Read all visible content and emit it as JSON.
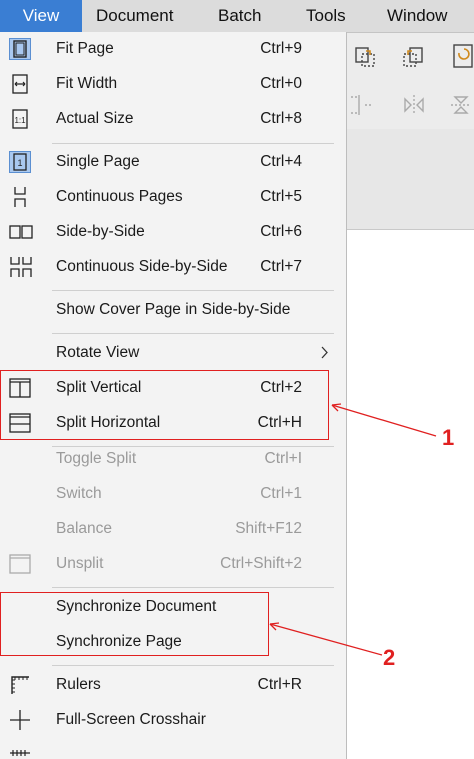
{
  "menubar": {
    "items": [
      "View",
      "Document",
      "Batch",
      "Tools",
      "Window"
    ]
  },
  "menu": {
    "items": [
      {
        "label": "Fit Page",
        "shortcut": "Ctrl+9"
      },
      {
        "label": "Fit Width",
        "shortcut": "Ctrl+0"
      },
      {
        "label": "Actual Size",
        "shortcut": "Ctrl+8"
      },
      {
        "label": "Single Page",
        "shortcut": "Ctrl+4"
      },
      {
        "label": "Continuous Pages",
        "shortcut": "Ctrl+5"
      },
      {
        "label": "Side-by-Side",
        "shortcut": "Ctrl+6"
      },
      {
        "label": "Continuous Side-by-Side",
        "shortcut": "Ctrl+7"
      },
      {
        "label": "Show Cover Page in Side-by-Side",
        "shortcut": ""
      },
      {
        "label": "Rotate View",
        "shortcut": ""
      },
      {
        "label": "Split Vertical",
        "shortcut": "Ctrl+2"
      },
      {
        "label": "Split Horizontal",
        "shortcut": "Ctrl+H"
      },
      {
        "label": "Toggle Split",
        "shortcut": "Ctrl+I"
      },
      {
        "label": "Switch",
        "shortcut": "Ctrl+1"
      },
      {
        "label": "Balance",
        "shortcut": "Shift+F12"
      },
      {
        "label": "Unsplit",
        "shortcut": "Ctrl+Shift+2"
      },
      {
        "label": "Synchronize Document",
        "shortcut": ""
      },
      {
        "label": "Synchronize Page",
        "shortcut": ""
      },
      {
        "label": "Rulers",
        "shortcut": "Ctrl+R"
      },
      {
        "label": "Full-Screen Crosshair",
        "shortcut": ""
      }
    ]
  },
  "annotations": {
    "callout_1": "1",
    "callout_2": "2"
  },
  "colors": {
    "active_menu": "#3a7ed3",
    "selected_icon_bg": "#a9c8ef",
    "callout": "#e02020"
  },
  "icons": [
    "fit-page-icon",
    "fit-width-icon",
    "actual-size-icon",
    "single-page-icon",
    "continuous-pages-icon",
    "side-by-side-icon",
    "continuous-side-by-side-icon",
    "split-vertical-icon",
    "split-horizontal-icon",
    "unsplit-icon",
    "rulers-icon",
    "crosshair-icon",
    "chevron-right-icon"
  ]
}
